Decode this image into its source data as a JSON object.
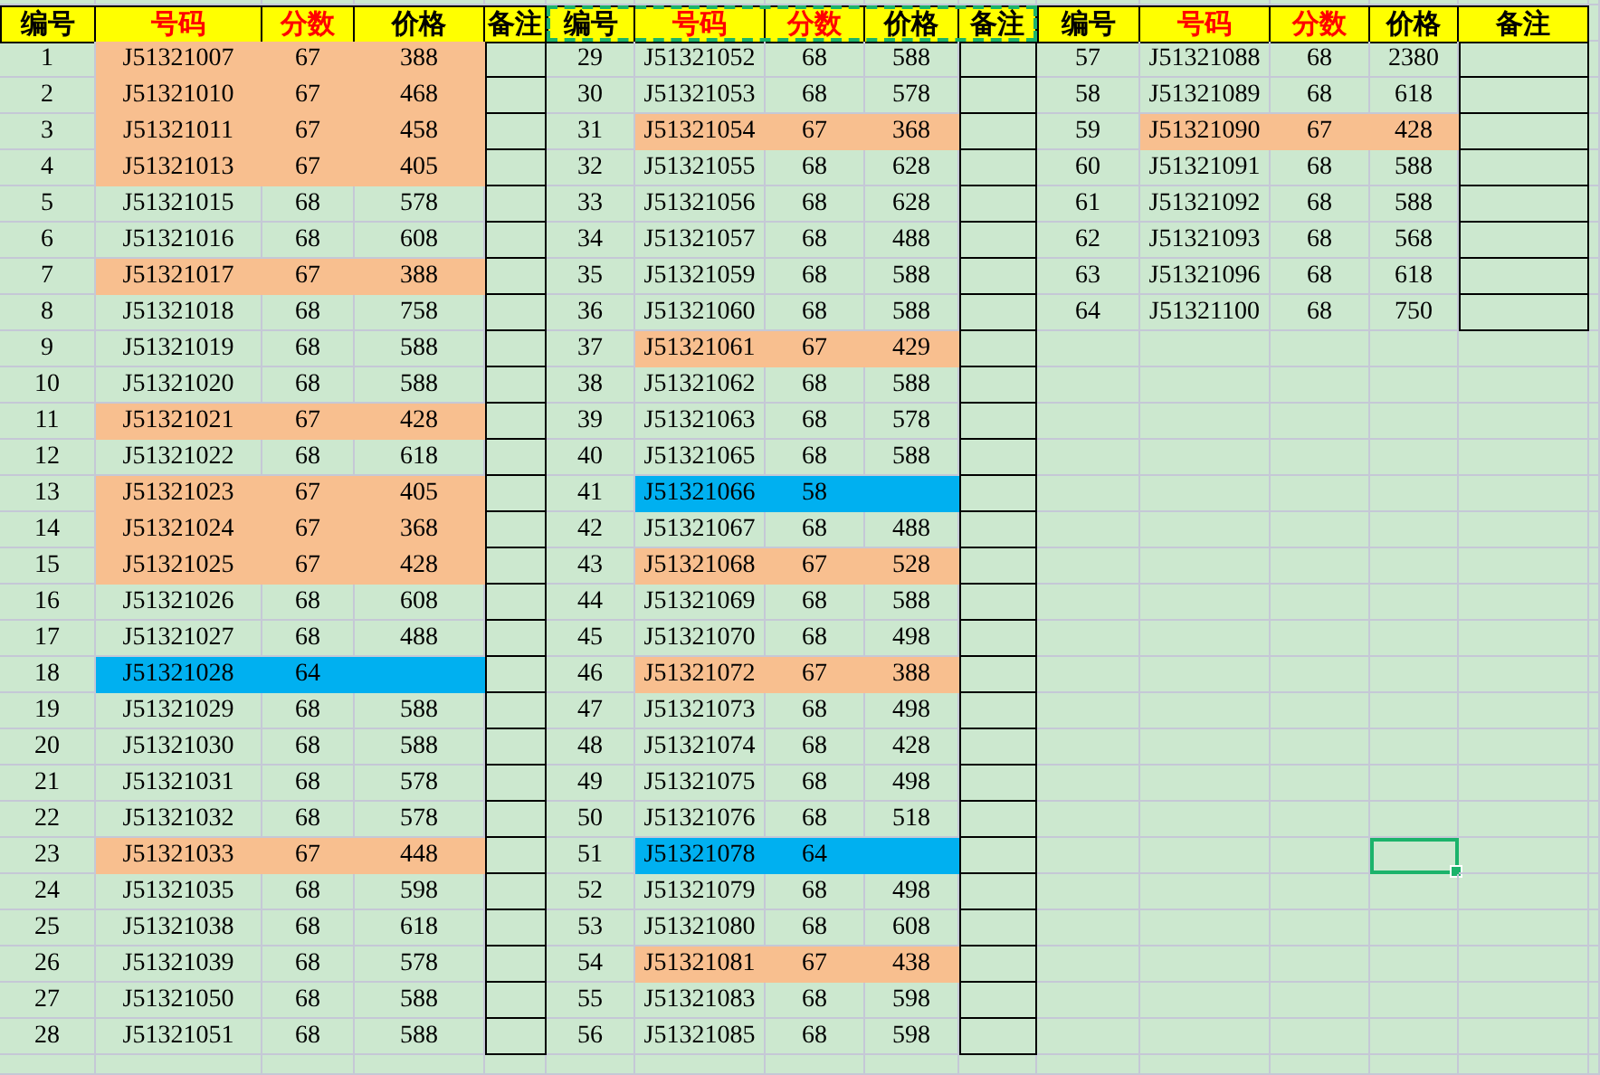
{
  "tables": [
    {
      "columns": [
        {
          "label": "编号",
          "emphasis": false
        },
        {
          "label": "号码",
          "emphasis": true
        },
        {
          "label": "分数",
          "emphasis": true
        },
        {
          "label": "价格",
          "emphasis": false
        },
        {
          "label": "备注",
          "emphasis": false
        }
      ],
      "rows": [
        {
          "no": "1",
          "code": "J51321007",
          "score": "67",
          "price": "388",
          "color": "#f8bf8f",
          "selected": false
        },
        {
          "no": "2",
          "code": "J51321010",
          "score": "67",
          "price": "468",
          "color": "#f8bf8f",
          "selected": false
        },
        {
          "no": "3",
          "code": "J51321011",
          "score": "67",
          "price": "458",
          "color": "#f8bf8f",
          "selected": false
        },
        {
          "no": "4",
          "code": "J51321013",
          "score": "67",
          "price": "405",
          "color": "#f8bf8f",
          "selected": false
        },
        {
          "no": "5",
          "code": "J51321015",
          "score": "68",
          "price": "578",
          "selected": false
        },
        {
          "no": "6",
          "code": "J51321016",
          "score": "68",
          "price": "608",
          "selected": false
        },
        {
          "no": "7",
          "code": "J51321017",
          "score": "67",
          "price": "388",
          "color": "#f8bf8f",
          "selected": false
        },
        {
          "no": "8",
          "code": "J51321018",
          "score": "68",
          "price": "758",
          "selected": false
        },
        {
          "no": "9",
          "code": "J51321019",
          "score": "68",
          "price": "588",
          "selected": false
        },
        {
          "no": "10",
          "code": "J51321020",
          "score": "68",
          "price": "588",
          "selected": false
        },
        {
          "no": "11",
          "code": "J51321021",
          "score": "67",
          "price": "428",
          "color": "#f8bf8f",
          "selected": false
        },
        {
          "no": "12",
          "code": "J51321022",
          "score": "68",
          "price": "618",
          "selected": false
        },
        {
          "no": "13",
          "code": "J51321023",
          "score": "67",
          "price": "405",
          "color": "#f8bf8f",
          "selected": false
        },
        {
          "no": "14",
          "code": "J51321024",
          "score": "67",
          "price": "368",
          "color": "#f8bf8f",
          "selected": false
        },
        {
          "no": "15",
          "code": "J51321025",
          "score": "67",
          "price": "428",
          "color": "#f8bf8f",
          "selected": false
        },
        {
          "no": "16",
          "code": "J51321026",
          "score": "68",
          "price": "608",
          "selected": false
        },
        {
          "no": "17",
          "code": "J51321027",
          "score": "68",
          "price": "488",
          "selected": false
        },
        {
          "no": "18",
          "code": "J51321028",
          "score": "64",
          "color": "#00b0f0",
          "selected": false
        },
        {
          "no": "19",
          "code": "J51321029",
          "score": "68",
          "price": "588",
          "selected": false
        },
        {
          "no": "20",
          "code": "J51321030",
          "score": "68",
          "price": "588",
          "selected": false
        },
        {
          "no": "21",
          "code": "J51321031",
          "score": "68",
          "price": "578",
          "selected": false
        },
        {
          "no": "22",
          "code": "J51321032",
          "score": "68",
          "price": "578",
          "selected": false
        },
        {
          "no": "23",
          "code": "J51321033",
          "score": "67",
          "price": "448",
          "color": "#f8bf8f",
          "selected": false
        },
        {
          "no": "24",
          "code": "J51321035",
          "score": "68",
          "price": "598",
          "selected": false
        },
        {
          "no": "25",
          "code": "J51321038",
          "score": "68",
          "price": "618",
          "selected": false
        },
        {
          "no": "26",
          "code": "J51321039",
          "score": "68",
          "price": "578",
          "selected": false
        },
        {
          "no": "27",
          "code": "J51321050",
          "score": "68",
          "price": "588",
          "selected": false
        },
        {
          "no": "28",
          "code": "J51321051",
          "score": "68",
          "price": "588",
          "selected": false
        }
      ]
    },
    {
      "copy_marquee": true,
      "columns": [
        {
          "label": "编号",
          "emphasis": false
        },
        {
          "label": "号码",
          "emphasis": true
        },
        {
          "label": "分数",
          "emphasis": true
        },
        {
          "label": "价格",
          "emphasis": false
        },
        {
          "label": "备注",
          "emphasis": false
        }
      ],
      "rows": [
        {
          "no": "29",
          "code": "J51321052",
          "score": "68",
          "price": "588",
          "selected": false
        },
        {
          "no": "30",
          "code": "J51321053",
          "score": "68",
          "price": "578",
          "selected": false
        },
        {
          "no": "31",
          "code": "J51321054",
          "score": "67",
          "price": "368",
          "color": "#f8bf8f",
          "selected": false
        },
        {
          "no": "32",
          "code": "J51321055",
          "score": "68",
          "price": "628",
          "selected": false
        },
        {
          "no": "33",
          "code": "J51321056",
          "score": "68",
          "price": "628",
          "selected": false
        },
        {
          "no": "34",
          "code": "J51321057",
          "score": "68",
          "price": "488",
          "selected": false
        },
        {
          "no": "35",
          "code": "J51321059",
          "score": "68",
          "price": "588",
          "selected": false
        },
        {
          "no": "36",
          "code": "J51321060",
          "score": "68",
          "price": "588",
          "selected": false
        },
        {
          "no": "37",
          "code": "J51321061",
          "score": "67",
          "price": "429",
          "color": "#f8bf8f",
          "selected": false
        },
        {
          "no": "38",
          "code": "J51321062",
          "score": "68",
          "price": "588",
          "selected": false
        },
        {
          "no": "39",
          "code": "J51321063",
          "score": "68",
          "price": "578",
          "selected": false
        },
        {
          "no": "40",
          "code": "J51321065",
          "score": "68",
          "price": "588",
          "selected": false
        },
        {
          "no": "41",
          "code": "J51321066",
          "score": "58",
          "color": "#00b0f0",
          "selected": false
        },
        {
          "no": "42",
          "code": "J51321067",
          "score": "68",
          "price": "488",
          "selected": false
        },
        {
          "no": "43",
          "code": "J51321068",
          "score": "67",
          "price": "528",
          "color": "#f8bf8f",
          "selected": false
        },
        {
          "no": "44",
          "code": "J51321069",
          "score": "68",
          "price": "588",
          "selected": false
        },
        {
          "no": "45",
          "code": "J51321070",
          "score": "68",
          "price": "498",
          "selected": false
        },
        {
          "no": "46",
          "code": "J51321072",
          "score": "67",
          "price": "388",
          "color": "#f8bf8f",
          "selected": false
        },
        {
          "no": "47",
          "code": "J51321073",
          "score": "68",
          "price": "498",
          "selected": false
        },
        {
          "no": "48",
          "code": "J51321074",
          "score": "68",
          "price": "428",
          "selected": false
        },
        {
          "no": "49",
          "code": "J51321075",
          "score": "68",
          "price": "498",
          "selected": false
        },
        {
          "no": "50",
          "code": "J51321076",
          "score": "68",
          "price": "518",
          "selected": false
        },
        {
          "no": "51",
          "code": "J51321078",
          "score": "64",
          "color": "#00b0f0",
          "selected": false
        },
        {
          "no": "52",
          "code": "J51321079",
          "score": "68",
          "price": "498",
          "selected": false
        },
        {
          "no": "53",
          "code": "J51321080",
          "score": "68",
          "price": "608",
          "selected": false
        },
        {
          "no": "54",
          "code": "J51321081",
          "score": "67",
          "price": "438",
          "color": "#f8bf8f",
          "selected": false
        },
        {
          "no": "55",
          "code": "J51321083",
          "score": "68",
          "price": "598",
          "selected": false
        },
        {
          "no": "56",
          "code": "J51321085",
          "score": "68",
          "price": "598",
          "selected": false
        }
      ]
    },
    {
      "columns": [
        {
          "label": "编号",
          "emphasis": false
        },
        {
          "label": "号码",
          "emphasis": true
        },
        {
          "label": "分数",
          "emphasis": true
        },
        {
          "label": "价格",
          "emphasis": false
        },
        {
          "label": "备注",
          "emphasis": false
        }
      ],
      "rows": [
        {
          "no": "57",
          "code": "J51321088",
          "score": "68",
          "price": "2380",
          "selected": false
        },
        {
          "no": "58",
          "code": "J51321089",
          "score": "68",
          "price": "618",
          "selected": false
        },
        {
          "no": "59",
          "code": "J51321090",
          "score": "67",
          "price": "428",
          "color": "#f8bf8f",
          "selected": false
        },
        {
          "no": "60",
          "code": "J51321091",
          "score": "68",
          "price": "588",
          "selected": false
        },
        {
          "no": "61",
          "code": "J51321092",
          "score": "68",
          "price": "588",
          "selected": false
        },
        {
          "no": "62",
          "code": "J51321093",
          "score": "68",
          "price": "568",
          "selected": false
        },
        {
          "no": "63",
          "code": "J51321096",
          "score": "68",
          "price": "618",
          "selected": false
        },
        {
          "no": "64",
          "code": "J51321100",
          "score": "68",
          "price": "750",
          "selected": false
        },
        {
          "selected": false
        },
        {
          "selected": false
        },
        {
          "selected": false
        },
        {
          "selected": false
        },
        {
          "selected": false
        },
        {
          "selected": false
        },
        {
          "selected": false
        },
        {
          "selected": false
        },
        {
          "selected": false
        },
        {
          "selected": false
        },
        {
          "selected": false
        },
        {
          "selected": false
        },
        {
          "selected": false
        },
        {
          "selected": false
        },
        {
          "selected": true
        },
        {
          "selected": false
        },
        {
          "selected": false
        },
        {
          "selected": false
        },
        {
          "selected": false
        },
        {
          "selected": false
        }
      ]
    }
  ]
}
